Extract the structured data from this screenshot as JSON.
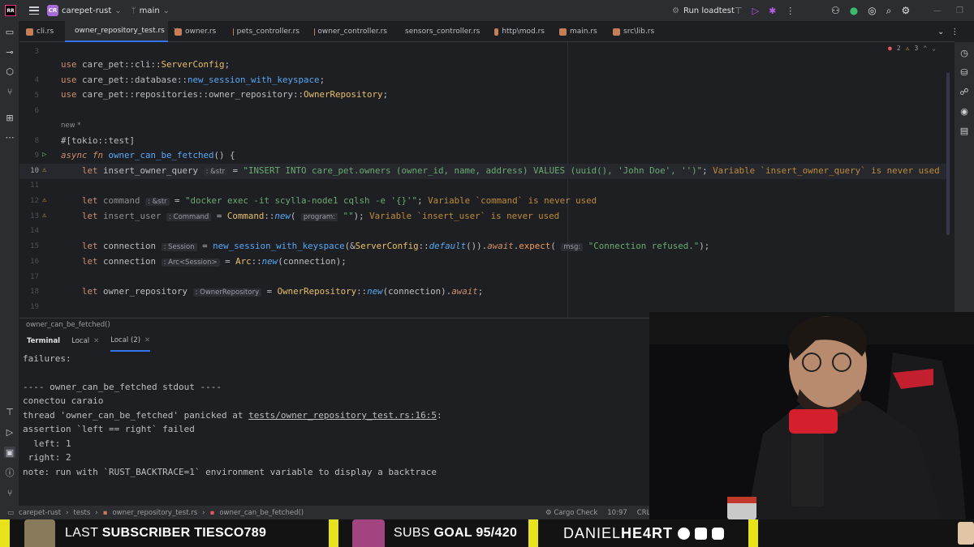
{
  "titlebar": {
    "ide_badge": "RR",
    "project_initials": "CR",
    "project_name": "carepet-rust",
    "branch": "main",
    "run_config": "Run loadtest"
  },
  "tabs": [
    {
      "label": "cli.rs"
    },
    {
      "label": "owner_repository_test.rs",
      "active": true
    },
    {
      "label": "owner.rs"
    },
    {
      "label": "pets_controller.rs"
    },
    {
      "label": "owner_controller.rs"
    },
    {
      "label": "sensors_controller.rs"
    },
    {
      "label": "http\\mod.rs"
    },
    {
      "label": "main.rs"
    },
    {
      "label": "src\\lib.rs"
    }
  ],
  "editor": {
    "inspections": {
      "errors": "2",
      "warnings": "3"
    },
    "line_numbers": [
      "3",
      "4",
      "5",
      "6",
      "8",
      "9",
      "10",
      "11",
      "12",
      "13",
      "14",
      "15",
      "16",
      "17",
      "18",
      "19"
    ],
    "usage_hint": "new *",
    "hints": {
      "t_str": ": &str",
      "t_command": ": Command",
      "t_session": ": Session",
      "t_arc": ": Arc<Session>",
      "t_repo": ": OwnerRepository",
      "p_program": "program:",
      "p_msg": "msg:"
    },
    "lines": {
      "l3_path": "care_pet::cli::",
      "l3_type": "ServerConfig",
      "l4_path": "care_pet::database::",
      "l4_fn": "new_session_with_keyspace",
      "l5_path": "care_pet::repositories::owner_repository::",
      "l5_type": "OwnerRepository",
      "l8_attr": "#[tokio::test]",
      "l9_sig": "async fn",
      "l9_name": "owner_can_be_fetched",
      "l9_rest": "() {",
      "l10_var": "insert_owner_query",
      "l10_str": "\"INSERT INTO care_pet.owners (owner_id, name, address) VALUES (uuid(), 'John Doe', '')\"",
      "l10_warn": "Variable `insert_owner_query` is never used",
      "l12_var": "command",
      "l12_str": "\"docker exec -it scylla-node1 cqlsh -e '{}'\"",
      "l12_warn": "Variable `command` is never used",
      "l13_var": "insert_user",
      "l13_warn": "Variable `insert_user` is never used",
      "l15_var": "connection",
      "l15_str": "\"Connection refused.\"",
      "l16_var": "connection",
      "l18_var": "owner_repository"
    }
  },
  "breadcrumb_fn": "owner_can_be_fetched()",
  "terminal": {
    "title": "Terminal",
    "tabs": [
      "Local",
      "Local (2)"
    ],
    "lines": [
      "failures:",
      "",
      "---- owner_can_be_fetched stdout ----",
      "conectou caraio",
      "",
      "",
      "assertion `left == right` failed",
      "  left: 1",
      " right: 2",
      "note: run with `RUST_BACKTRACE=1` environment variable to display a backtrace"
    ],
    "panic_prefix": "thread 'owner_can_be_fetched' panicked at ",
    "panic_link": "tests/owner_repository_test.rs:16:5",
    "panic_suffix": ":"
  },
  "status": {
    "crumbs": [
      "carepet-rust",
      "tests",
      "owner_repository_test.rs",
      "owner_can_be_fetched()"
    ],
    "cargo": "Cargo Check",
    "position": "10:97",
    "line_sep": "CRLF",
    "encoding": "UT"
  },
  "overlay": {
    "last_sub_label": "LAST",
    "last_sub_bold": "SUBSCRIBER TIESCO789",
    "subs_label": "SUBS",
    "subs_bold": "GOAL 95/420",
    "brand_light": "DANIEL",
    "brand_bold": "HE4RT",
    "accent": "#e6e31a"
  }
}
